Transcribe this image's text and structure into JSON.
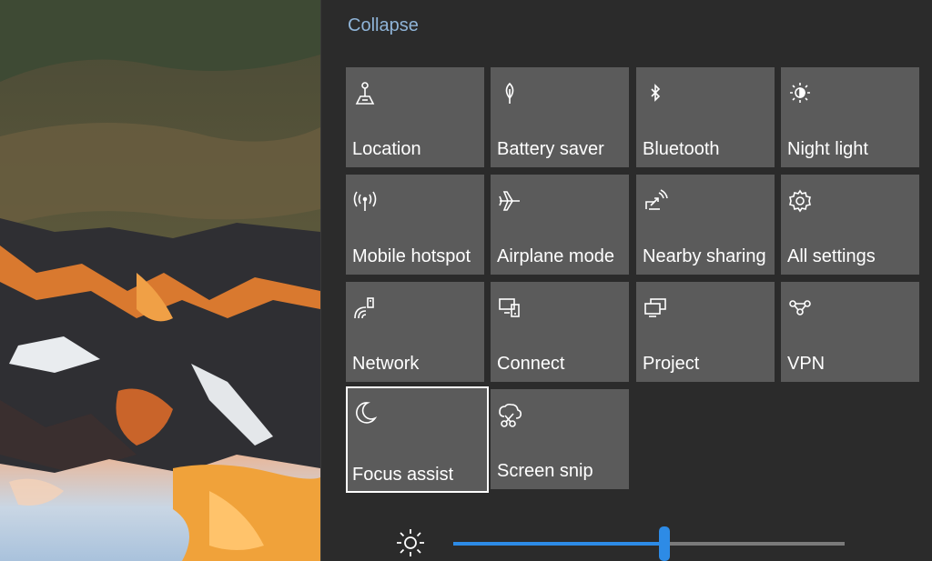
{
  "action_center": {
    "collapse_label": "Collapse",
    "tiles": [
      {
        "label": "Location",
        "icon": "location-icon",
        "focused": false
      },
      {
        "label": "Battery saver",
        "icon": "battery-saver-icon",
        "focused": false
      },
      {
        "label": "Bluetooth",
        "icon": "bluetooth-icon",
        "focused": false
      },
      {
        "label": "Night light",
        "icon": "night-light-icon",
        "focused": false
      },
      {
        "label": "Mobile hotspot",
        "icon": "mobile-hotspot-icon",
        "focused": false
      },
      {
        "label": "Airplane mode",
        "icon": "airplane-icon",
        "focused": false
      },
      {
        "label": "Nearby sharing",
        "icon": "nearby-sharing-icon",
        "focused": false
      },
      {
        "label": "All settings",
        "icon": "gear-icon",
        "focused": false
      },
      {
        "label": "Network",
        "icon": "network-icon",
        "focused": false
      },
      {
        "label": "Connect",
        "icon": "connect-icon",
        "focused": false
      },
      {
        "label": "Project",
        "icon": "project-icon",
        "focused": false
      },
      {
        "label": "VPN",
        "icon": "vpn-icon",
        "focused": false
      },
      {
        "label": "Focus assist",
        "icon": "moon-icon",
        "focused": true
      },
      {
        "label": "Screen snip",
        "icon": "screen-snip-icon",
        "focused": false
      }
    ],
    "brightness": {
      "icon": "brightness-icon",
      "level_fraction": 0.54
    }
  },
  "colors": {
    "panel_bg": "#2b2b2b",
    "tile_bg": "#5b5b5b",
    "accent": "#2d8be6",
    "collapse_link": "#8fb4d8"
  }
}
